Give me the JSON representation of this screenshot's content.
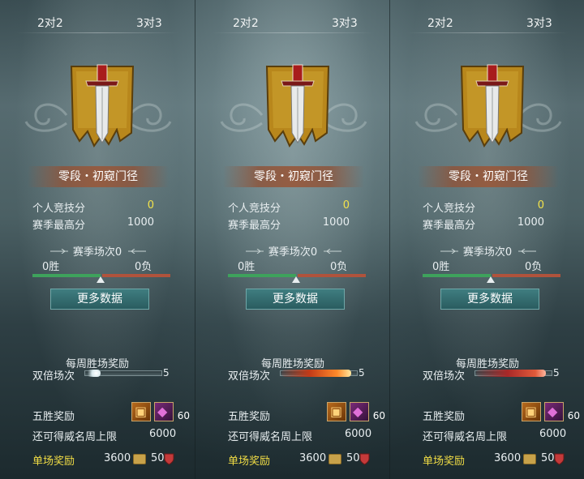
{
  "panels": [
    {
      "tabs": [
        "2对2",
        "3对3"
      ],
      "rank": "零段・初窥门径",
      "personal_label": "个人竞技分",
      "personal_value": "0",
      "season_high_label": "赛季最高分",
      "season_high_value": "1000",
      "season_matches": "赛季场次0",
      "wins": "0胜",
      "losses": "0负",
      "more_data": "更多数据",
      "weekly_title": "每周胜场奖励",
      "double_label": "双倍场次",
      "double_count": "5",
      "five_win_label": "五胜奖励",
      "item1_count": "5",
      "item2_count": "60",
      "cap_label": "还可得威名周上限",
      "cap_value": "6000",
      "single_label": "单场奖励",
      "single_coin": "3600",
      "single_shield": "50"
    },
    {
      "tabs": [
        "2对2",
        "3对3"
      ],
      "rank": "零段・初窥门径",
      "personal_label": "个人竞技分",
      "personal_value": "0",
      "season_high_label": "赛季最高分",
      "season_high_value": "1000",
      "season_matches": "赛季场次0",
      "wins": "0胜",
      "losses": "0负",
      "more_data": "更多数据",
      "weekly_title": "每周胜场奖励",
      "double_label": "双倍场次",
      "double_count": "5",
      "five_win_label": "五胜奖励",
      "item1_count": "5",
      "item2_count": "60",
      "cap_label": "还可得威名周上限",
      "cap_value": "6000",
      "single_label": "单场奖励",
      "single_coin": "3600",
      "single_shield": "50"
    },
    {
      "tabs": [
        "2对2",
        "3对3"
      ],
      "rank": "零段・初窥门径",
      "personal_label": "个人竞技分",
      "personal_value": "0",
      "season_high_label": "赛季最高分",
      "season_high_value": "1000",
      "season_matches": "赛季场次0",
      "wins": "0胜",
      "losses": "0负",
      "more_data": "更多数据",
      "weekly_title": "每周胜场奖励",
      "double_label": "双倍场次",
      "double_count": "5",
      "five_win_label": "五胜奖励",
      "item1_count": "5",
      "item2_count": "60",
      "cap_label": "还可得威名周上限",
      "cap_value": "6000",
      "single_label": "单场奖励",
      "single_coin": "3600",
      "single_shield": "50"
    }
  ],
  "icons": {
    "emblem": "sword-banner-icon",
    "item1": "treasure-chest-icon",
    "item2": "purple-gem-icon",
    "coin": "coin-icon",
    "shield": "shield-icon"
  },
  "colors": {
    "zero_value": "#f3e24a",
    "single_label": "#f0dc45",
    "win_bar": "#3ea25c",
    "loss_bar": "#b0533c",
    "button": "#2a5c60"
  }
}
